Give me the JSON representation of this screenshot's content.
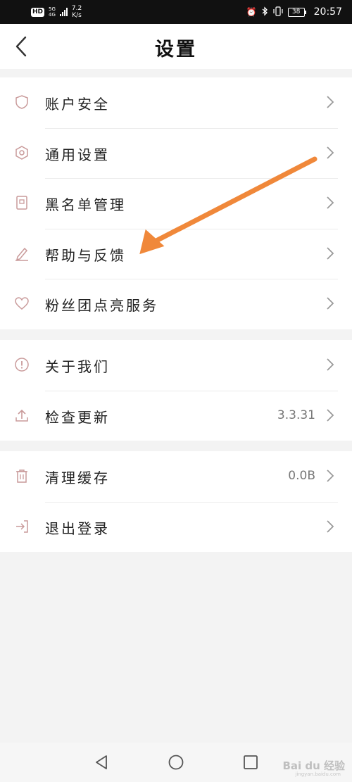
{
  "status_bar": {
    "hd": "HD",
    "net_5g": "5G",
    "net_4g": "4G",
    "speed_value": "7.2",
    "speed_unit": "K/s",
    "battery": "38",
    "time": "20:57"
  },
  "header": {
    "title": "设置"
  },
  "groups": [
    {
      "items": [
        {
          "label": "账户安全",
          "icon": "shield-icon"
        },
        {
          "label": "通用设置",
          "icon": "hexagon-settings-icon"
        },
        {
          "label": "黑名单管理",
          "icon": "blacklist-book-icon"
        },
        {
          "label": "帮助与反馈",
          "icon": "pencil-icon"
        },
        {
          "label": "粉丝团点亮服务",
          "icon": "heart-icon"
        }
      ]
    },
    {
      "items": [
        {
          "label": "关于我们",
          "icon": "info-circle-icon"
        },
        {
          "label": "检查更新",
          "icon": "upload-icon",
          "value": "3.3.31"
        }
      ]
    },
    {
      "items": [
        {
          "label": "清理缓存",
          "icon": "trash-icon",
          "value": "0.0B"
        },
        {
          "label": "退出登录",
          "icon": "logout-icon"
        }
      ]
    }
  ],
  "watermark": {
    "brand": "Bai du 经验",
    "url": "jingyan.baidu.com"
  },
  "colors": {
    "icon": "#c99a9a",
    "arrow": "#f0883a"
  }
}
